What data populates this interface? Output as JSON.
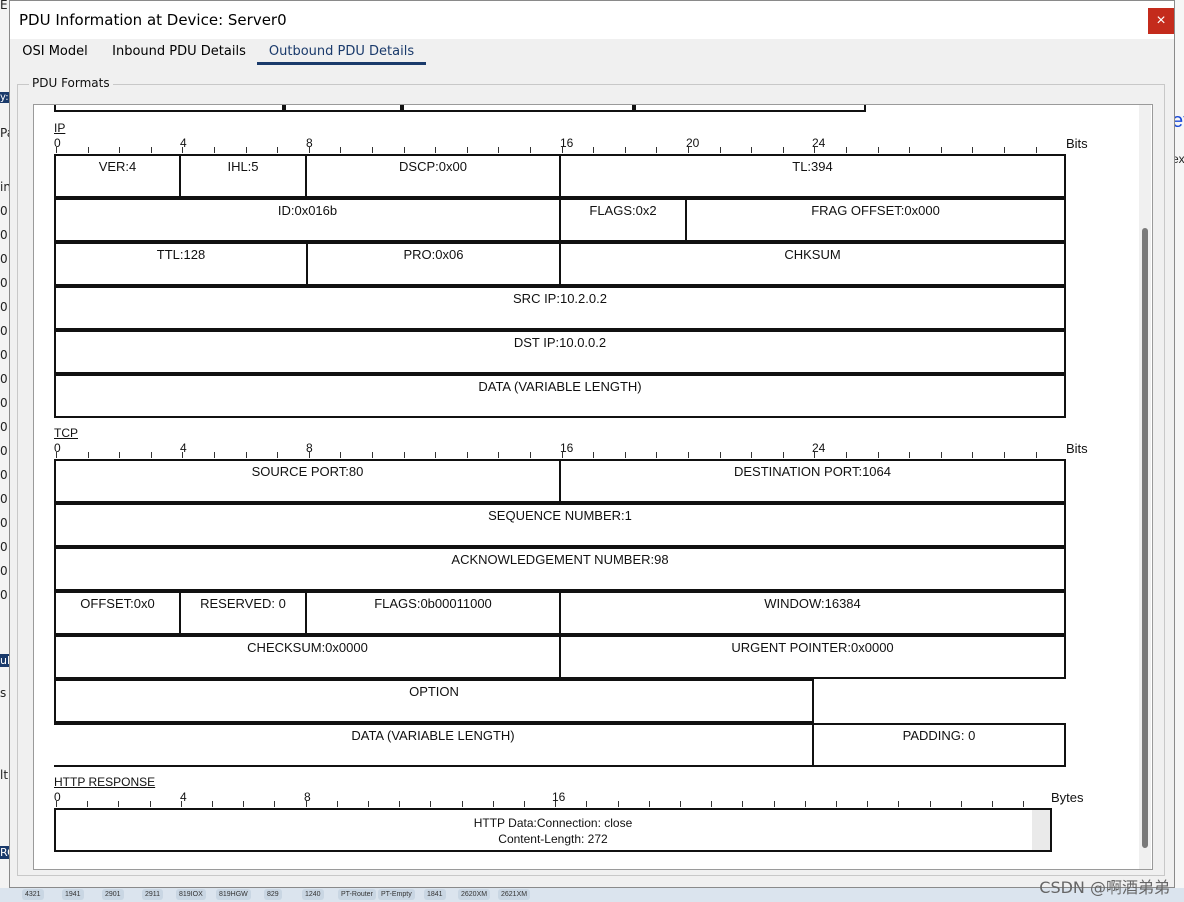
{
  "window": {
    "title": "PDU Information at Device: Server0",
    "close_label": "×"
  },
  "tabs": [
    {
      "label": "OSI Model"
    },
    {
      "label": "Inbound PDU Details"
    },
    {
      "label": "Outbound PDU Details",
      "active": true
    }
  ],
  "group_label": "PDU Formats",
  "ruler_bits": {
    "numbers": [
      "0",
      "4",
      "8",
      "16",
      "20",
      "24"
    ],
    "unit": "Bits"
  },
  "ruler_tcp": {
    "numbers": [
      "0",
      "4",
      "8",
      "16",
      "24"
    ],
    "unit": "Bits"
  },
  "ruler_http": {
    "numbers": [
      "0",
      "4",
      "8",
      "16"
    ],
    "unit": "Bytes"
  },
  "ip": {
    "title": "IP",
    "ver": "VER:4",
    "ihl": "IHL:5",
    "dscp": "DSCP:0x00",
    "tl": "TL:394",
    "id": "ID:0x016b",
    "flags": "FLAGS:0x2",
    "frag": "FRAG OFFSET:0x000",
    "ttl": "TTL:128",
    "pro": "PRO:0x06",
    "chksum": "CHKSUM",
    "src": "SRC IP:10.2.0.2",
    "dst": "DST IP:10.0.0.2",
    "data": "DATA (VARIABLE LENGTH)"
  },
  "tcp": {
    "title": "TCP",
    "src_port": "SOURCE PORT:80",
    "dst_port": "DESTINATION PORT:1064",
    "seq": "SEQUENCE NUMBER:1",
    "ack": "ACKNOWLEDGEMENT NUMBER:98",
    "offset": "OFFSET:0x0",
    "reserved": "RESERVED: 0",
    "flags": "FLAGS:0b00011000",
    "window": "WINDOW:16384",
    "checksum": "CHECKSUM:0x0000",
    "urgent": "URGENT POINTER:0x0000",
    "option": "OPTION",
    "data": "DATA (VARIABLE LENGTH)",
    "padding": "PADDING: 0"
  },
  "http": {
    "title": "HTTP RESPONSE",
    "line1": "HTTP Data:Connection: close",
    "line2": "Content-Length: 272"
  },
  "background": {
    "left_chars": [
      "E",
      "y:",
      "Pa",
      "in",
      "0",
      "0",
      "0",
      "0",
      "0",
      "0",
      "0",
      "0",
      "0",
      "0",
      "0",
      "0",
      "0",
      "0",
      "0",
      "0",
      "0",
      "ula",
      "s",
      "lt",
      "RC"
    ],
    "right_chars": [
      "et",
      "ex"
    ],
    "bottom_devices": [
      "4321",
      "1941",
      "2901",
      "2911",
      "819IOX",
      "819HGW",
      "829",
      "1240",
      "PT-Router",
      "PT-Empty",
      "1841",
      "2620XM",
      "2621XM"
    ],
    "watermark": "CSDN @啊酒弟弟"
  },
  "colors": {
    "tab_active": "#1a3a6b",
    "close": "#c42b1c"
  }
}
